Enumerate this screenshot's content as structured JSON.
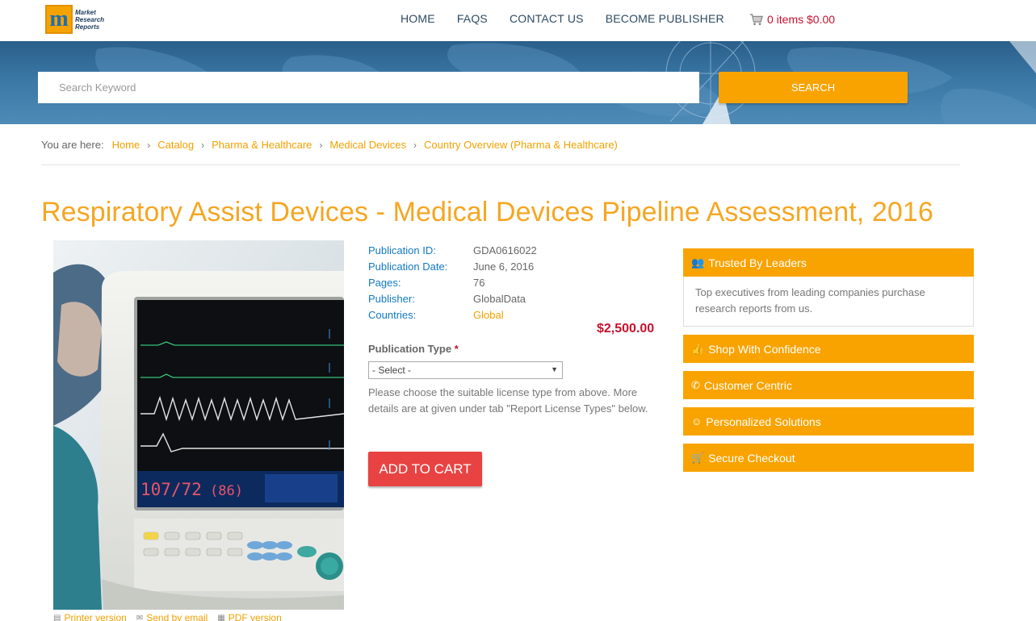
{
  "header": {
    "logo_lines": [
      "Market",
      "Research",
      "Reports"
    ],
    "logo_letter": "m",
    "nav": [
      "HOME",
      "FAQS",
      "CONTACT US",
      "BECOME PUBLISHER"
    ],
    "cart": "0 items $0.00",
    "cart_icon": "shopping-cart-icon"
  },
  "search": {
    "placeholder": "Search Keyword",
    "button": "SEARCH"
  },
  "breadcrumb": {
    "lead": "You are here:",
    "items": [
      "Home",
      "Catalog",
      "Pharma & Healthcare",
      "Medical Devices",
      "Country Overview (Pharma & Healthcare)"
    ],
    "separator": "›"
  },
  "title": "Respiratory Assist Devices - Medical Devices Pipeline Assessment, 2016",
  "monitor": {
    "reading_primary": "107/72",
    "reading_secondary": "(86)"
  },
  "product_links": [
    "Printer version",
    "Send by email",
    "PDF version"
  ],
  "details": [
    {
      "label": "Publication ID:",
      "value": "GDA0616022"
    },
    {
      "label": "Publication Date:",
      "value": "June 6, 2016"
    },
    {
      "label": "Pages:",
      "value": "76"
    },
    {
      "label": "Publisher:",
      "value": "GlobalData"
    },
    {
      "label": "Countries:",
      "value": "Global"
    }
  ],
  "price": "$2,500.00",
  "publication_type": {
    "label": "Publication Type",
    "required_mark": "*",
    "selected": "- Select -",
    "help": "Please choose the suitable license type from above. More details are at given under tab \"Report License Types\" below."
  },
  "add_to_cart": "ADD TO CART",
  "sidebar": [
    {
      "title": "Trusted By Leaders",
      "icon": "users-icon",
      "body": "Top executives from leading companies purchase research reports from us."
    },
    {
      "title": "Shop With Confidence",
      "icon": "thumbs-up-icon"
    },
    {
      "title": "Customer Centric",
      "icon": "phone-icon"
    },
    {
      "title": "Personalized Solutions",
      "icon": "smile-icon"
    },
    {
      "title": "Secure Checkout",
      "icon": "cart-icon"
    }
  ],
  "colors": {
    "accent": "#f8a300",
    "title": "#f5a623",
    "price": "#c8102e",
    "label_blue": "#1279c4",
    "cart_button": "#e94242",
    "nav_text": "#2e4a63"
  }
}
